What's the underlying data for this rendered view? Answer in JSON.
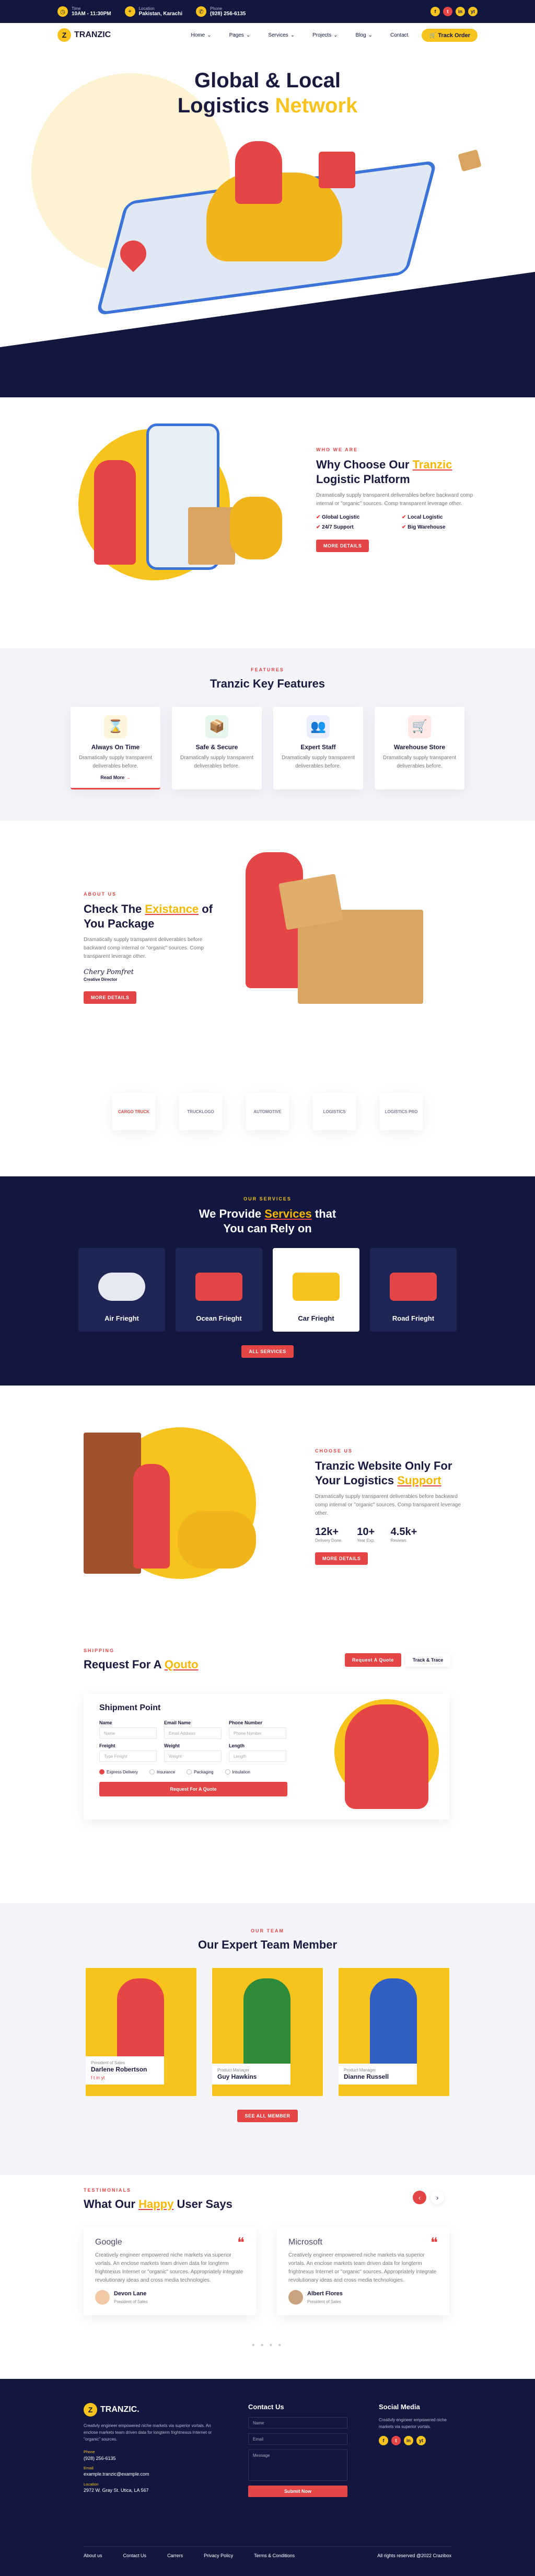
{
  "topbar": {
    "time_label": "Time",
    "time": "10AM - 11:30PM",
    "location_label": "Location",
    "location": "Pakistan, Karachi",
    "phone_label": "Phone",
    "phone": "(928) 256-6135",
    "socials": [
      "f",
      "t",
      "in",
      "yt"
    ]
  },
  "nav": {
    "brand": "TRANZIC",
    "menu": [
      "Home",
      "Pages",
      "Services",
      "Projects",
      "Blog",
      "Contact"
    ],
    "cta": "Track Order"
  },
  "hero": {
    "title_1": "Global & Local",
    "title_2": "Logistics ",
    "title_highlight": "Network"
  },
  "about": {
    "eyebrow": "Who We Are",
    "title_1": "Why Choose Our ",
    "title_highlight": "Tranzic",
    "title_2": "Logistic Platform",
    "text": "Dramatically supply transparent deliverables before backward comp internal or \"organic\" sources. Comp transparent leverage other.",
    "checks": [
      "Global Logistic",
      "Local Logistic",
      "24/7 Support",
      "Big Warehouse"
    ],
    "button": "More Details"
  },
  "features": {
    "eyebrow": "Features",
    "title": "Tranzic Key Features",
    "cards": [
      {
        "icon": "hourglass-icon",
        "emoji": "⌛",
        "title": "Always On Time",
        "text": "Dramatically supply transparent deliverables before.",
        "link": "Read More"
      },
      {
        "icon": "shield-box-icon",
        "emoji": "📦",
        "title": "Safe & Secure",
        "text": "Dramatically supply transparent deliverables before.",
        "link": ""
      },
      {
        "icon": "team-icon",
        "emoji": "👥",
        "title": "Expert Staff",
        "text": "Dramatically supply transparent deliverables before.",
        "link": ""
      },
      {
        "icon": "cart-icon",
        "emoji": "🛒",
        "title": "Warehouse Store",
        "text": "Dramatically supply transparent deliverables before.",
        "link": ""
      }
    ]
  },
  "existance": {
    "eyebrow": "About Us",
    "title_1": "Check The ",
    "title_highlight": "Existance",
    "title_2": " of You Package",
    "text": "Dramatically supply transparent deliverables before backward comp internal or \"organic\" sources. Comp transparent leverage other.",
    "signature": "Chery Pomfret",
    "role": "Creative Director",
    "button": "More Details"
  },
  "brands": [
    "CARGO TRUCK",
    "TRUCKLOGO",
    "AUTOMOTIVE",
    "LOGISTICS",
    "LOGISTICS PRO"
  ],
  "services": {
    "eyebrow": "Our Services",
    "title_1": "We Provide ",
    "title_highlight": "Services",
    "title_2": " that",
    "title_3": "You can Rely on",
    "cards": [
      "Air Frieght",
      "Ocean Frieght",
      "Car Frieght",
      "Road Frieght"
    ],
    "button": "All Services"
  },
  "why": {
    "eyebrow": "Choose Us",
    "title_1": "Tranzic Website Only For",
    "title_2": "Your Logistics ",
    "title_highlight": "Support",
    "text": "Dramatically supply transparent deliverables before backward comp internal or \"organic\" sources. Comp transparent leverage other.",
    "stats": [
      {
        "value": "12k+",
        "label": "Delivery Done"
      },
      {
        "value": "10+",
        "label": "Year Exp."
      },
      {
        "value": "4.5k+",
        "label": "Reviews"
      }
    ],
    "button": "More Details"
  },
  "quote": {
    "eyebrow": "Shipping",
    "title_1": "Request For A ",
    "title_highlight": "Qouto",
    "tabs": [
      "Request A Quote",
      "Track & Trace"
    ],
    "form_title": "Shipment Point",
    "labels": [
      "Name",
      "Email Name",
      "Phone Number",
      "Freight",
      "Weight",
      "Length"
    ],
    "placeholders": [
      "Name",
      "Email Address",
      "Phone Number",
      "Type Freight",
      "Weight",
      "Length"
    ],
    "options": [
      "Express Delivery",
      "Insurance",
      "Packaging",
      "Insulation"
    ],
    "submit": "Request For A Quote"
  },
  "team": {
    "eyebrow": "Our Team",
    "title": "Our Expert Team Member",
    "members": [
      {
        "role": "President of Sales",
        "name": "Darlene Robertson"
      },
      {
        "role": "Product Manager",
        "name": "Guy Hawkins"
      },
      {
        "role": "Product Manager",
        "name": "Dianne Russell"
      }
    ],
    "button": "See All Member"
  },
  "testimonials": {
    "eyebrow": "Testimonials",
    "title_1": "What Our ",
    "title_highlight": "Happy",
    "title_2": " User Says",
    "items": [
      {
        "brand": "Google",
        "text": "Creatively engineer empowered niche markets via superior vortals. An enclose markets team driven data for longterm frightnexus Internet or \"organic\" sources. Appropriately integrate revolutionary ideas and cross media technologies.",
        "name": "Devon Lane",
        "role": "President of Sales"
      },
      {
        "brand": "Microsoft",
        "text": "Creatively engineer empowered niche markets via superior vortals. An enclose markets team driven data for longterm frightnexus Internet or \"organic\" sources. Appropriately integrate revolutionary ideas and cross media technologies.",
        "name": "Albert Flores",
        "role": "President of Sales"
      }
    ]
  },
  "footer": {
    "brand": "TRANZIC.",
    "about": "Creativly engineer empowered niche markets via superior vortals. An enclose markets team driven data for longterm frightnexus Internet or \"organic\" sources.",
    "phone_label": "Phone",
    "phone": "(928) 256-6135",
    "email_label": "Email",
    "email": "example.tranzic@example.com",
    "address_label": "Location",
    "address": "2972 W. Gray St. Utica, LA 567",
    "contact_title": "Contact Us",
    "contact_placeholders": [
      "Name",
      "Email",
      "Message"
    ],
    "submit": "Submit Now",
    "social_title": "Social Media",
    "social_text": "Creativly engineer empowered niche markets via superior vortals.",
    "links": [
      "About us",
      "Contact Us",
      "Carrers",
      "Privacy Policy",
      "Terms & Conditions"
    ],
    "copyright": "All rights reserved @2022 Crazibox"
  },
  "colors": {
    "navy": "#12173f",
    "yellow": "#f7c31c",
    "red": "#e64545"
  }
}
